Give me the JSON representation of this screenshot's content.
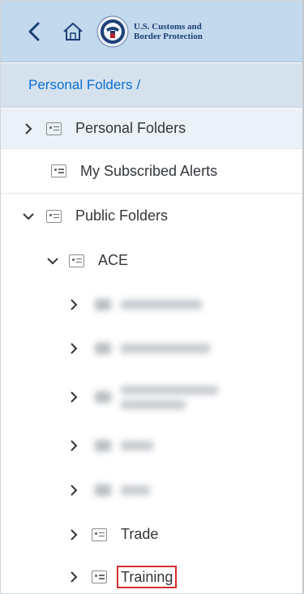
{
  "shellbar": {
    "logo_line1": "U.S. Customs and",
    "logo_line2": "Border Protection"
  },
  "breadcrumb": {
    "link": "Personal Folders",
    "separator": "/"
  },
  "tree": {
    "personal_folders": "Personal Folders",
    "my_subscribed_alerts": "My Subscribed Alerts",
    "public_folders": "Public Folders",
    "ace": "ACE",
    "trade": "Trade",
    "training": "Training"
  },
  "colors": {
    "shellbar_bg": "#c3d9ed",
    "breadcrumb_bg": "#d5e2ee",
    "link": "#0a6ed1",
    "highlight": "#d32f2f"
  },
  "icons": [
    "back-chevron-icon",
    "home-icon",
    "cbp-seal-icon",
    "chevron-right-icon",
    "chevron-down-icon",
    "folder-icon"
  ]
}
